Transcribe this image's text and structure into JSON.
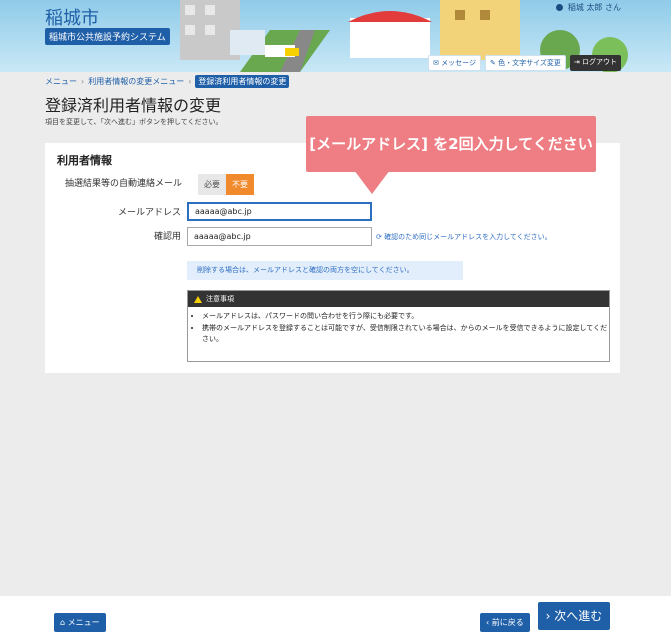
{
  "header": {
    "city": "稲城市",
    "system": "稲城市公共施設予約システム",
    "user": "稲城 太郎 さん",
    "message_btn": "メッセージ",
    "color_btn": "色・文字サイズ変更",
    "logout_btn": "ログアウト"
  },
  "breadcrumb": {
    "item1": "メニュー",
    "item2": "利用者情報の変更メニュー",
    "current": "登録済利用者情報の変更",
    "sep": "›"
  },
  "page": {
    "title": "登録済利用者情報の変更",
    "description": "項目を変更して、「次へ進む」ボタンを押してください。"
  },
  "form": {
    "section_title": "利用者情報",
    "notify_label": "抽選結果等の自動連絡メール",
    "toggle_need": "必要",
    "toggle_noneed": "不要",
    "email_label": "メールアドレス",
    "email_value": "aaaaa@abc.jp",
    "confirm_label": "確認用",
    "confirm_value": "aaaaa@abc.jp",
    "confirm_hint": "確認のため同じメールアドレスを入力してください。",
    "delete_note": "削除する場合は、メールアドレスと確認の両方を空にしてください。"
  },
  "caution": {
    "title": "注意事項",
    "items": [
      "メールアドレスは、パスワードの問い合わせを行う際にも必要です。",
      "携帯のメールアドレスを登録することは可能ですが、受信制限されている場合は、からのメールを受信できるように設定してください。"
    ]
  },
  "callout": {
    "text": "[メールアドレス] を2回入力してください"
  },
  "footer": {
    "menu_btn": "メニュー",
    "back_btn": "前に戻る",
    "next_btn": "次へ進む"
  },
  "colors": {
    "brand": "#1f5fa8",
    "toggle_active": "#f08a2c",
    "callout": "#ee7e83"
  }
}
